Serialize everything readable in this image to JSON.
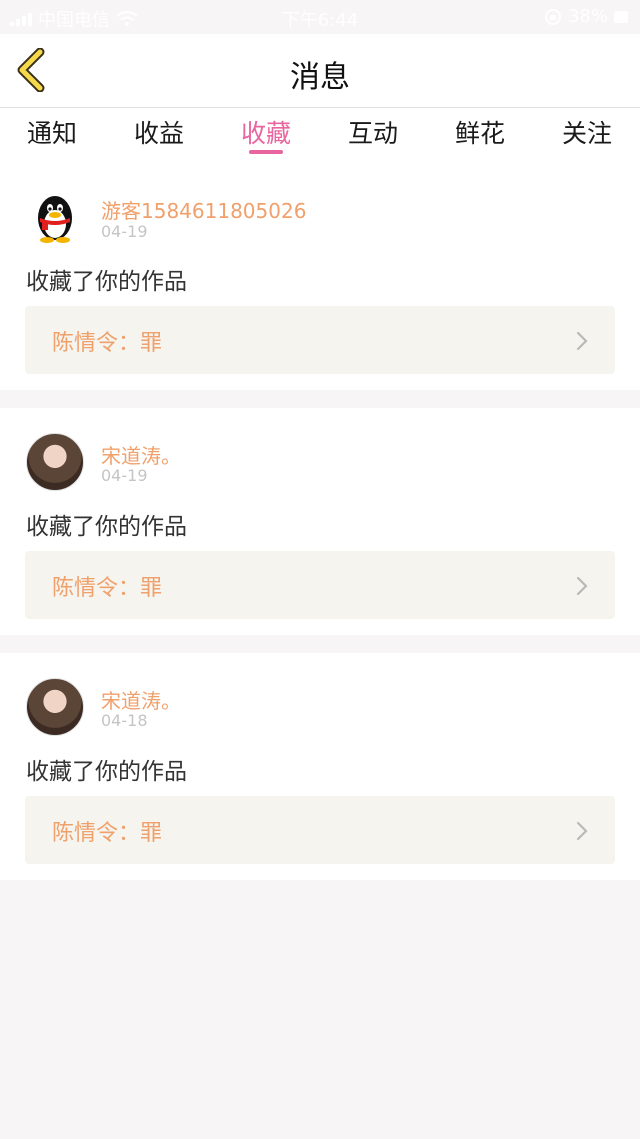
{
  "status_bar": {
    "carrier": "中国电信",
    "time": "下午6:44",
    "battery": "38%"
  },
  "nav": {
    "title": "消息"
  },
  "tabs": [
    {
      "label": "通知"
    },
    {
      "label": "收益"
    },
    {
      "label": "收藏"
    },
    {
      "label": "互动"
    },
    {
      "label": "鲜花"
    },
    {
      "label": "关注"
    }
  ],
  "messages": [
    {
      "username": "游客1584611805026",
      "date": "04-19",
      "action": "收藏了你的作品",
      "work": "陈情令：罪",
      "avatar_icon": "qq-penguin-icon"
    },
    {
      "username": "宋道涛。",
      "date": "04-19",
      "action": "收藏了你的作品",
      "work": "陈情令：罪",
      "avatar_icon": "user-photo"
    },
    {
      "username": "宋道涛。",
      "date": "04-18",
      "action": "收藏了你的作品",
      "work": "陈情令：罪",
      "avatar_icon": "user-photo"
    }
  ],
  "colors": {
    "accent": "#e9659f",
    "username": "#f0a06b",
    "work_box_bg": "#f5f4ee"
  }
}
